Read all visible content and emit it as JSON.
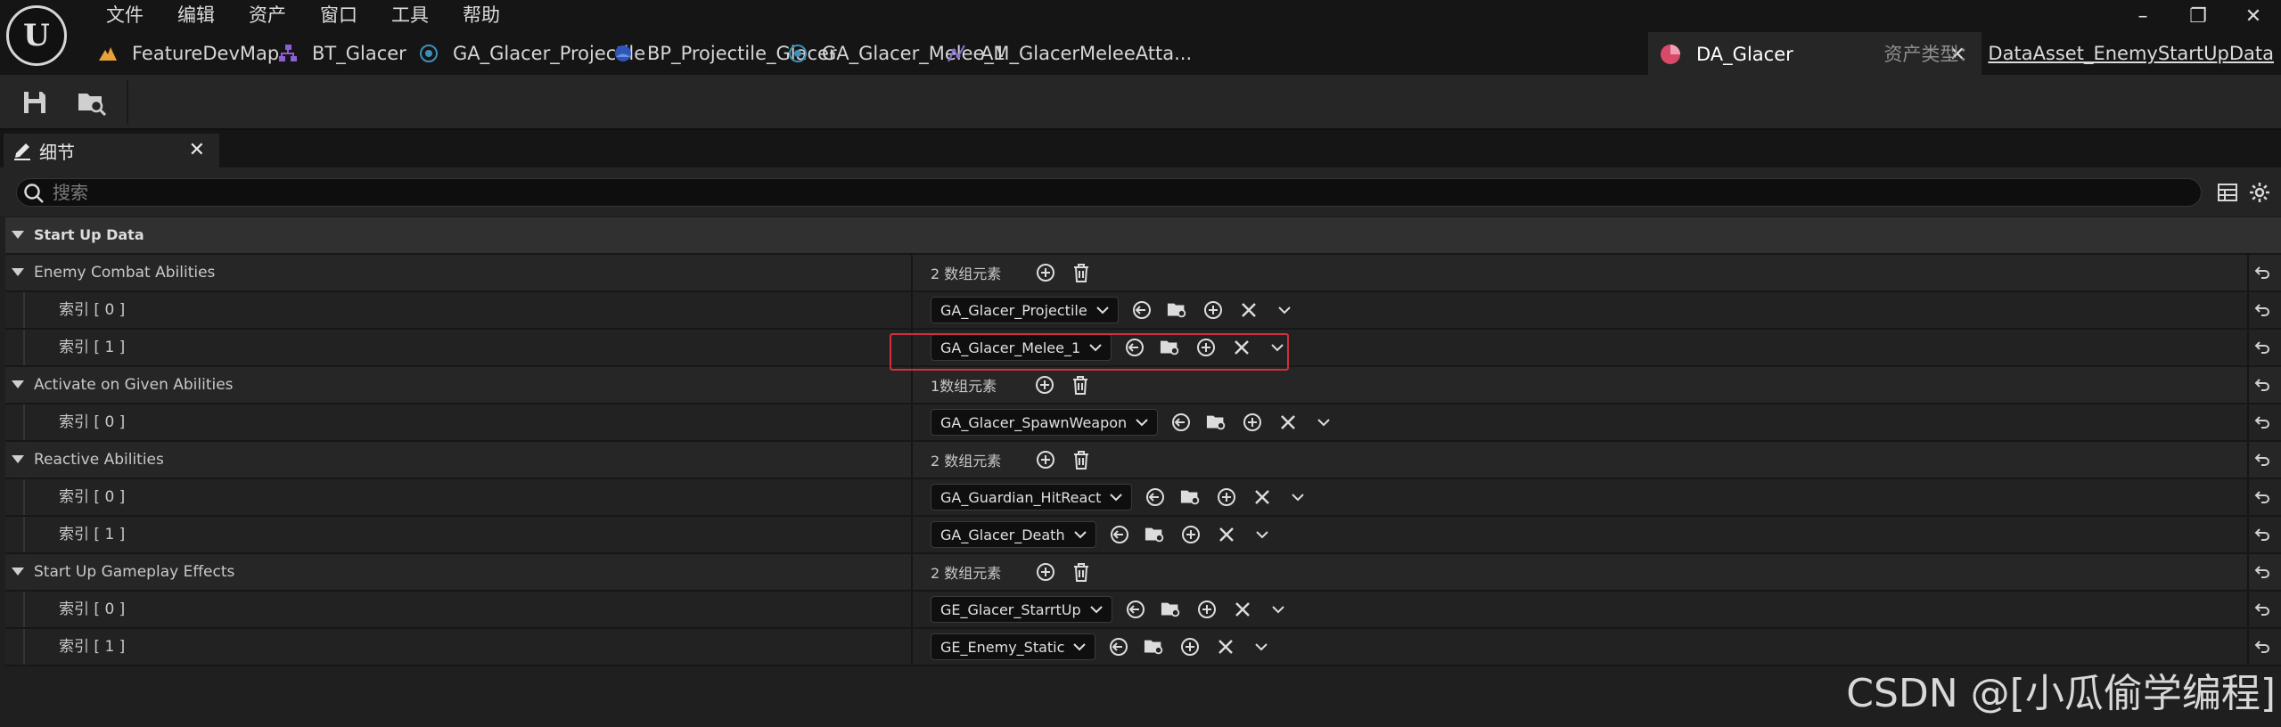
{
  "app": {
    "logo_text": "U"
  },
  "menu": [
    {
      "label": "文件"
    },
    {
      "label": "编辑"
    },
    {
      "label": "资产"
    },
    {
      "label": "窗口"
    },
    {
      "label": "工具"
    },
    {
      "label": "帮助"
    }
  ],
  "window_controls": {
    "minimize": "–",
    "restore": "❐",
    "close": "✕"
  },
  "tabs": [
    {
      "label": "FeatureDevMap",
      "icon": "level-icon",
      "color": "#e8a23a"
    },
    {
      "label": "BT_Glacer",
      "icon": "behavior-tree-icon",
      "color": "#8e5fd4"
    },
    {
      "label": "GA_Glacer_Projectile",
      "icon": "blueprint-icon",
      "color": "#3f8fb8"
    },
    {
      "label": "BP_Projectile_Glacer",
      "icon": "blueprint-actor-icon",
      "color": "#3c6fd8"
    },
    {
      "label": "GA_Glacer_Melee_1",
      "icon": "blueprint-icon",
      "color": "#3f8fb8"
    },
    {
      "label": "AM_GlacerMeleeAtta...",
      "icon": "anim-montage-icon",
      "color": "#8e70d8"
    },
    {
      "label": "DA_Glacer",
      "icon": "data-asset-icon",
      "color": "#d84a6a",
      "active": true
    }
  ],
  "asset_type": {
    "label": "资产类型：",
    "value": "DataAsset_EnemyStartUpData"
  },
  "toolbar": {
    "save_icon": "save-icon",
    "browse_icon": "browse-icon"
  },
  "panel": {
    "title": "细节",
    "close": "✕"
  },
  "search": {
    "placeholder": "搜索"
  },
  "details": {
    "category": "Start Up Data",
    "groups": [
      {
        "label": "Enemy Combat Abilities",
        "count": "2 数组元素",
        "items": [
          {
            "index": "索引 [ 0 ]",
            "value": "GA_Glacer_Projectile"
          },
          {
            "index": "索引 [ 1 ]",
            "value": "GA_Glacer_Melee_1"
          }
        ]
      },
      {
        "label": "Activate on Given Abilities",
        "count": "1数组元素",
        "items": [
          {
            "index": "索引 [ 0 ]",
            "value": "GA_Glacer_SpawnWeapon"
          }
        ]
      },
      {
        "label": "Reactive Abilities",
        "count": "2 数组元素",
        "items": [
          {
            "index": "索引 [ 0 ]",
            "value": "GA_Guardian_HitReact"
          },
          {
            "index": "索引 [ 1 ]",
            "value": "GA_Glacer_Death"
          }
        ]
      },
      {
        "label": "Start Up Gameplay Effects",
        "count": "2 数组元素",
        "items": [
          {
            "index": "索引 [ 0 ]",
            "value": "GE_Glacer_StarrtUp"
          },
          {
            "index": "索引 [ 1 ]",
            "value": "GE_Enemy_Static"
          }
        ]
      }
    ]
  },
  "watermark": "CSDN @[小瓜偷学编程]"
}
